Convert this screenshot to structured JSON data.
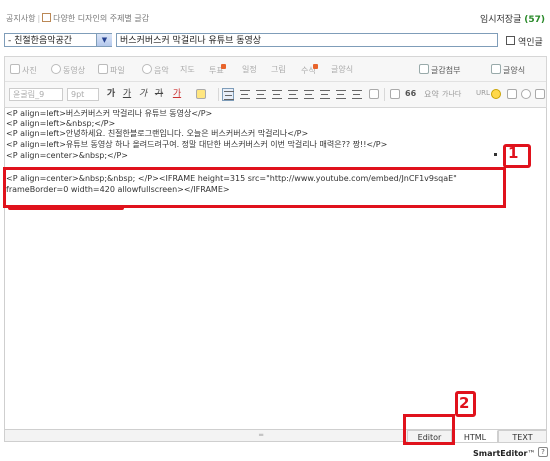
{
  "topline": {
    "notice": "공지사항",
    "template": "다양한 디자인의 주제별 글감"
  },
  "draft": {
    "label": "임시저장글",
    "count": "(57)"
  },
  "category": {
    "selected": "- 친절한음악공간",
    "arrow": "▼"
  },
  "title": {
    "value": "버스커버스커 막걸리나 유튜브 동영상"
  },
  "translate": {
    "label": "역인글"
  },
  "toolbar": {
    "row1": {
      "photo": "사진",
      "video": "동영상",
      "file": "파일",
      "music": "음악",
      "map": "지도",
      "poll": "투표",
      "schedule": "일정",
      "image": "그림",
      "formula": "수식",
      "blog_post": "글양식",
      "attach_info": "글감첨부",
      "template": "글양식"
    },
    "row2": {
      "font": "윤굴림_9",
      "size": "9pt",
      "bold": "가",
      "underline": "가",
      "italic": "가",
      "strike": "가",
      "font_color": "가",
      "quote": "66",
      "sticker": "요약",
      "spell": "가나다",
      "url": "URL"
    }
  },
  "editor": {
    "lines": [
      "<P align=left>버스커버스커 막걸리나 유튜브 동영상</P>",
      "<P align=left>&nbsp;</P>",
      "<P align=left>안녕하세요. 친절한블로그랜입니다. 오늘은 버스커버스커 막걸리나</P>",
      "<P align=left>유튜브 동영상 하나 올려드려구여. 정말 대단한 버스커버스커 이번 막걸리나 매력은?? 짱!!</P>",
      "<P align=center>&nbsp;</P>",
      "<P align=center>&nbsp;&nbsp; </P><IFRAME height=315 src=\"http://www.youtube.com/embed/JnCF1v9sqaE\"",
      "frameBorder=0 width=420 allowfullscreen></IFRAME>"
    ]
  },
  "annotations": {
    "one": "1",
    "two": "2"
  },
  "modes": {
    "editor": "Editor",
    "html": "HTML",
    "text": "TEXT"
  },
  "resize": "═",
  "brand": {
    "name": "SmartEditor",
    "tm": "™",
    "help": "?"
  },
  "colors": {
    "annotation_red": "#e0121c",
    "draft_count": "#2a8a2a"
  }
}
